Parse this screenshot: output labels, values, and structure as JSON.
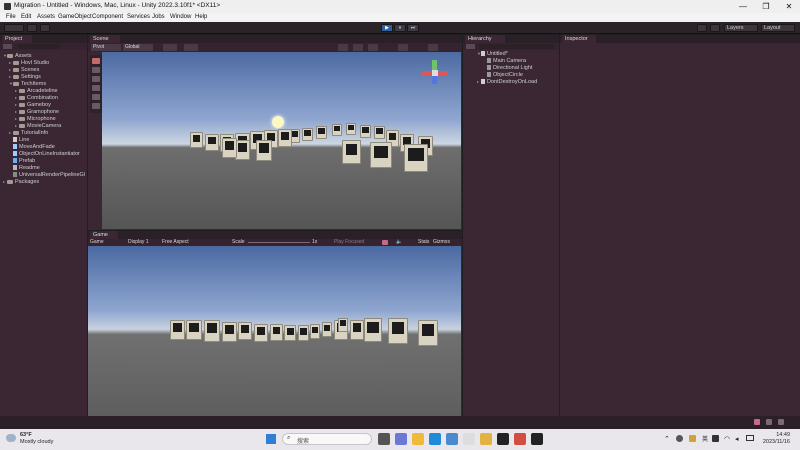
{
  "window": {
    "title": "Migration - Untitled - Windows, Mac, Linux - Unity 2022.3.10f1* <DX11>",
    "controls": [
      "—",
      "❐",
      "✕"
    ]
  },
  "menu": [
    "File",
    "Edit",
    "Assets",
    "GameObject",
    "Component",
    "Services",
    "Jobs",
    "Window",
    "Help"
  ],
  "toolbar": {
    "layers_label": "Layers",
    "layout_label": "Layout",
    "play": "▶",
    "pause": "⏸",
    "step": "⏭"
  },
  "project": {
    "tab": "Project",
    "root": "Assets",
    "items": [
      "Hovl Studio",
      "Scenes",
      "Settings",
      "TechItems",
      "Arcadeteline",
      "Combination",
      "Gameboy",
      "Gramophone",
      "Microphone",
      "MovieCamera",
      "TutorialInfo",
      "Line",
      "MoveAndFade",
      "ObjectOnLineInstantiator",
      "Prefab",
      "Readme",
      "UniversalRenderPipelineGl"
    ],
    "packages": "Packages"
  },
  "scene": {
    "tab": "Scene",
    "pivot_label": "Pivot",
    "global_label": "Global",
    "persp_label": "< Persp"
  },
  "game": {
    "tab": "Game",
    "mode": "Game",
    "display": "Display 1",
    "aspect": "Free Aspect",
    "scale_label": "Scale",
    "scale_value": "1x",
    "play_focused": "Play Focused",
    "stats": "Stats",
    "gizmos": "Gizmos"
  },
  "hierarchy": {
    "tab": "Hierarchy",
    "scene": "Untitled*",
    "items": [
      "Main Camera",
      "Directional Light",
      "ObjectCircle"
    ],
    "dont_destroy": "DontDestroyOnLoad"
  },
  "inspector": {
    "tab": "Inspector"
  },
  "taskbar": {
    "weather_temp": "63°F",
    "weather_desc": "Mostly cloudy",
    "search_placeholder": "搜索",
    "time": "14:49",
    "date": "2023/11/16",
    "ime": "英"
  },
  "colors": {
    "panel": "#3a2733",
    "tab_bg": "#2c2028",
    "accent_play": "#2f5f9c"
  }
}
